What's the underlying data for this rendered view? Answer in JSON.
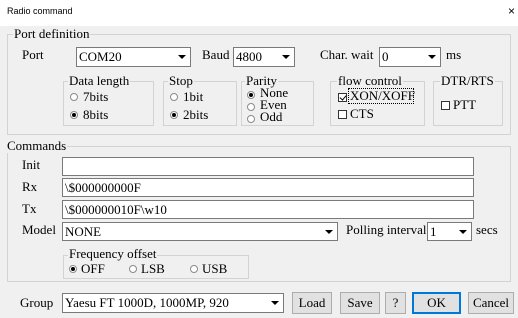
{
  "window": {
    "title": "Radio command",
    "close_glyph": "×"
  },
  "port_definition": {
    "legend": "Port definition",
    "port_label": "Port",
    "port_value": "COM20",
    "baud_label": "Baud",
    "baud_value": "4800",
    "char_wait_label": "Char. wait",
    "char_wait_value": "0",
    "char_wait_unit": "ms",
    "data_length": {
      "legend": "Data length",
      "options": [
        "7bits",
        "8bits"
      ],
      "selected": "8bits"
    },
    "stop": {
      "legend": "Stop",
      "options": [
        "1bit",
        "2bits"
      ],
      "selected": "2bits"
    },
    "parity": {
      "legend": "Parity",
      "options": [
        "None",
        "Even",
        "Odd"
      ],
      "selected": "None"
    },
    "flow_control": {
      "legend": "flow control",
      "options": [
        "XON/XOFF",
        "CTS"
      ],
      "checked": [
        "XON/XOFF"
      ]
    },
    "dtr_rts": {
      "legend": "DTR/RTS",
      "options": [
        "PTT"
      ],
      "checked": []
    }
  },
  "commands": {
    "legend": "Commands",
    "init_label": "Init",
    "init_value": "",
    "rx_label": "Rx",
    "rx_value": "\\$000000000F",
    "tx_label": "Tx",
    "tx_value": "\\$000000010F\\w10",
    "model_label": "Model",
    "model_value": "NONE",
    "polling_label": "Polling interval",
    "polling_value": "1",
    "polling_unit": "secs",
    "frequency_offset": {
      "legend": "Frequency offset",
      "options": [
        "OFF",
        "LSB",
        "USB"
      ],
      "selected": "OFF"
    }
  },
  "footer": {
    "group_label": "Group",
    "group_value": "Yaesu FT 1000D, 1000MP, 920",
    "load_label": "Load",
    "save_label": "Save",
    "help_label": "?",
    "ok_label": "OK",
    "cancel_label": "Cancel"
  }
}
